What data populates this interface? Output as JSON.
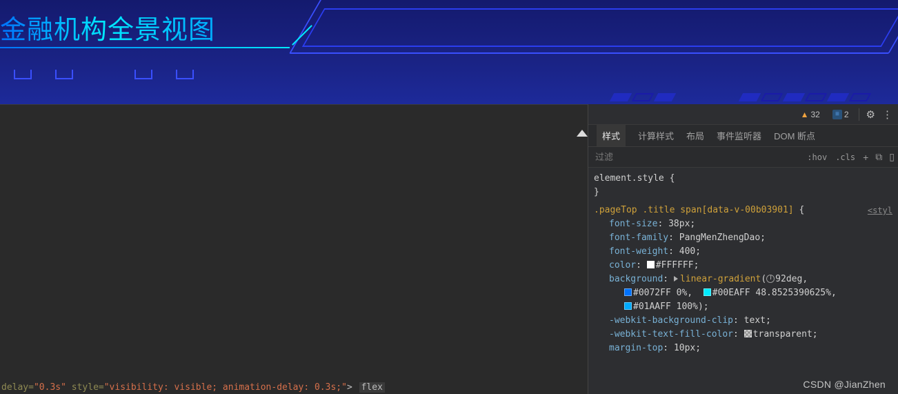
{
  "banner": {
    "title": "金融机构全景视图"
  },
  "toolbar": {
    "warnings_count": "32",
    "info_count": "2"
  },
  "styles_panel": {
    "tabs": {
      "styles": "样式",
      "computed": "计算样式",
      "layout": "布局",
      "event_listeners": "事件监听器",
      "dom_breakpoints": "DOM 断点"
    },
    "filter_placeholder": "过滤",
    "hov": ":hov",
    "cls": ".cls",
    "element_style_selector": "element.style",
    "selector_text": ".pageTop .title span[data-v-00b03901]",
    "source_link": "<styl",
    "declarations": {
      "font_size": {
        "prop": "font-size",
        "value": "38px"
      },
      "font_family": {
        "prop": "font-family",
        "value": "PangMenZhengDao"
      },
      "font_weight": {
        "prop": "font-weight",
        "value": "400"
      },
      "color": {
        "prop": "color",
        "swatch": "#FFFFFF",
        "value": "#FFFFFF"
      },
      "background": {
        "prop": "background",
        "fn": "linear-gradient",
        "angle": "92deg",
        "stops": [
          {
            "swatch": "#0072FF",
            "hex": "#0072FF",
            "pos": "0%"
          },
          {
            "swatch": "#00EAFF",
            "hex": "#00EAFF",
            "pos": "48.8525390625%"
          },
          {
            "swatch": "#01AAFF",
            "hex": "#01AAFF",
            "pos": "100%"
          }
        ]
      },
      "bg_clip": {
        "prop": "-webkit-background-clip",
        "value": "text"
      },
      "text_fill": {
        "prop": "-webkit-text-fill-color",
        "swatch": "transparent",
        "value": "transparent"
      },
      "margin_top": {
        "prop": "margin-top",
        "value": "10px"
      }
    }
  },
  "elements_panel": {
    "bottom_fragment": {
      "delay1": "\"0.3s\"",
      "style_attr": "style",
      "style_val": "\"visibility: visible; animation-delay: 0.3s;\"",
      "flex_badge": "flex"
    }
  },
  "watermark": "CSDN @JianZhen"
}
